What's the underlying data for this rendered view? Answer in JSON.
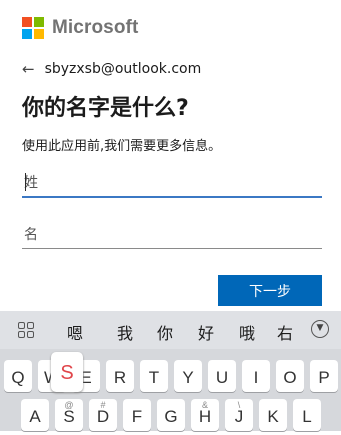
{
  "brand": {
    "name": "Microsoft",
    "logo_colors": [
      "#f25022",
      "#7fba00",
      "#00a4ef",
      "#ffb900"
    ]
  },
  "account": {
    "back_icon": "arrow-left-icon",
    "email": "sbyzxsb@outlook.com"
  },
  "main": {
    "title": "你的名字是什么?",
    "description": "使用此应用前,我们需要更多信息。",
    "surname_placeholder": "姓",
    "given_name_placeholder": "名",
    "next_label": "下一步",
    "accent_color": "#0067b8"
  },
  "ime": {
    "menu_icon": "grid-icon",
    "candidates": [
      "嗯",
      "我",
      "你",
      "好",
      "哦",
      "右"
    ],
    "collapse_icon": "chevron-down-icon",
    "pressed_key": "S",
    "row1": [
      {
        "label": "Q",
        "sub": ""
      },
      {
        "label": "W",
        "sub": ""
      },
      {
        "label": "E",
        "sub": ""
      },
      {
        "label": "R",
        "sub": ""
      },
      {
        "label": "T",
        "sub": ""
      },
      {
        "label": "Y",
        "sub": ""
      },
      {
        "label": "U",
        "sub": ""
      },
      {
        "label": "I",
        "sub": ""
      },
      {
        "label": "O",
        "sub": ""
      },
      {
        "label": "P",
        "sub": ""
      }
    ],
    "row2": [
      {
        "label": "A",
        "sub": ""
      },
      {
        "label": "S",
        "sub": "@"
      },
      {
        "label": "D",
        "sub": "#"
      },
      {
        "label": "F",
        "sub": ""
      },
      {
        "label": "G",
        "sub": ""
      },
      {
        "label": "H",
        "sub": "&"
      },
      {
        "label": "J",
        "sub": "\\"
      },
      {
        "label": "K",
        "sub": ""
      },
      {
        "label": "L",
        "sub": ""
      }
    ]
  }
}
